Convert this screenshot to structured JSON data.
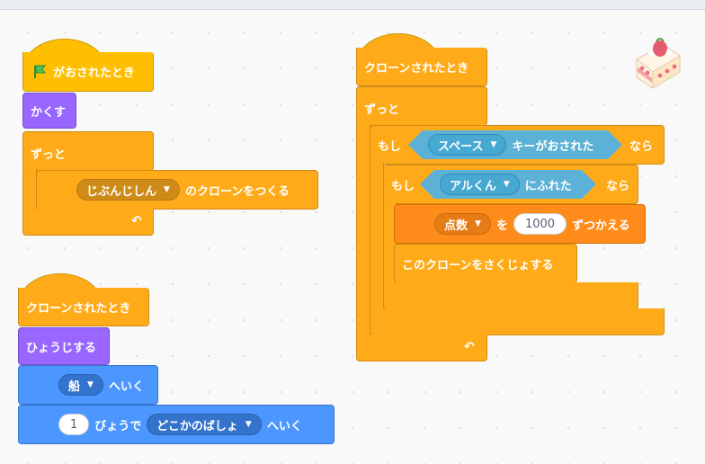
{
  "script1": {
    "hat": "がおされたとき",
    "hide": "かくす",
    "forever": "ずっと",
    "clone_target": "じぶんじしん",
    "clone_suffix": "のクローンをつくる"
  },
  "script2": {
    "hat": "クローンされたとき",
    "show": "ひょうじする",
    "goto_target": "船",
    "goto_suffix": "へいく",
    "glide_secs": "1",
    "glide_mid": "びょうで",
    "glide_target": "どこかのばしょ",
    "glide_suffix": "へいく"
  },
  "script3": {
    "hat": "クローンされたとき",
    "forever": "ずっと",
    "if1_prefix": "もし",
    "if1_key": "スペース",
    "if1_cond_suffix": "キーがおされた",
    "if1_then": "なら",
    "if2_prefix": "もし",
    "if2_target": "アルくん",
    "if2_cond_suffix": "にふれた",
    "if2_then": "なら",
    "change_var": "点数",
    "change_mid": "を",
    "change_value": "1000",
    "change_suffix": "ずつかえる",
    "delete_clone": "このクローンをさくじょする"
  },
  "icons": {
    "flag": "green-flag-icon",
    "caret": "dropdown-caret-icon",
    "loop_arrow": "loop-arrow-icon",
    "sprite_thumb": "cake-sprite-icon"
  },
  "colors": {
    "events": "#ffbf00",
    "control": "#ffab19",
    "looks": "#9966ff",
    "motion": "#4c97ff",
    "sensing": "#5cb1d6",
    "variables": "#ff8c1a"
  }
}
